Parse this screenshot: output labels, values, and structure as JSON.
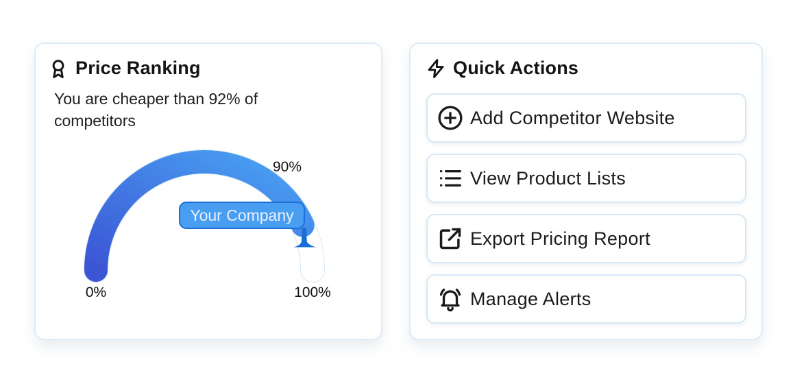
{
  "price_ranking": {
    "title": "Price Ranking",
    "icon": "award-icon",
    "description": "You are cheaper than 92% of competitors",
    "gauge": {
      "value_percent": 90,
      "min_label": "0%",
      "max_label": "100%",
      "value_label": "90%",
      "marker_label": "Your Company",
      "gradient_start": "#3b55d4",
      "gradient_end": "#4aa4f4",
      "track_color": "#dbe8f7"
    }
  },
  "quick_actions": {
    "title": "Quick Actions",
    "icon": "lightning-icon",
    "items": [
      {
        "label": "Add Competitor Website",
        "icon": "plus-circle-icon"
      },
      {
        "label": "View Product Lists",
        "icon": "list-icon"
      },
      {
        "label": "Export Pricing Report",
        "icon": "external-link-icon"
      },
      {
        "label": "Manage Alerts",
        "icon": "bell-icon"
      }
    ]
  },
  "colors": {
    "card_border": "#dcebf8",
    "marker_fill": "#4a9ef2",
    "marker_border": "#1a6fd6"
  }
}
